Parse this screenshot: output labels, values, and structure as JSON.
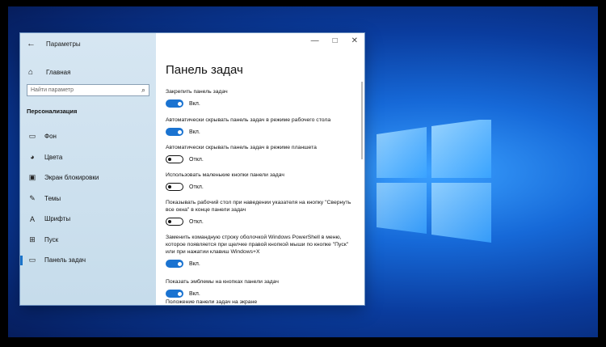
{
  "window": {
    "title": "Параметры"
  },
  "sidebar": {
    "home_label": "Главная",
    "search_placeholder": "Найти параметр",
    "section_title": "Персонализация",
    "items": [
      {
        "label": "Фон",
        "icon": "image-icon"
      },
      {
        "label": "Цвета",
        "icon": "palette-icon"
      },
      {
        "label": "Экран блокировки",
        "icon": "lock-screen-icon"
      },
      {
        "label": "Темы",
        "icon": "brush-icon"
      },
      {
        "label": "Шрифты",
        "icon": "font-icon"
      },
      {
        "label": "Пуск",
        "icon": "start-icon"
      },
      {
        "label": "Панель задач",
        "icon": "taskbar-icon",
        "active": true
      }
    ]
  },
  "main": {
    "title": "Панель задач",
    "settings": [
      {
        "label": "Закрепить панель задач",
        "state": "Вкл.",
        "on": true
      },
      {
        "label": "Автоматически скрывать панель задач в режиме рабочего стола",
        "state": "Вкл.",
        "on": true
      },
      {
        "label": "Автоматически скрывать панель задач в режиме планшета",
        "state": "Откл.",
        "on": false
      },
      {
        "label": "Использовать маленькие кнопки панели задач",
        "state": "Откл.",
        "on": false
      },
      {
        "label": "Показывать рабочий стол при наведении указателя на кнопку \"Свернуть все окна\" в конце панели задач",
        "state": "Откл.",
        "on": false
      },
      {
        "label": "Заменить командную строку оболочкой Windows PowerShell в меню, которое появляется при щелчке правой кнопкой мыши по кнопке \"Пуск\" или при нажатии клавиш Windows+X",
        "state": "Вкл.",
        "on": true
      },
      {
        "label": "Показать эмблемы на кнопках панели задач",
        "state": "Вкл.",
        "on": true
      }
    ],
    "cut_off_label": "Положение панели задач на экране"
  },
  "colors": {
    "accent": "#1a73d1",
    "sidebar_bg": "#cfe1ee",
    "desktop": "#0a3c9e"
  }
}
